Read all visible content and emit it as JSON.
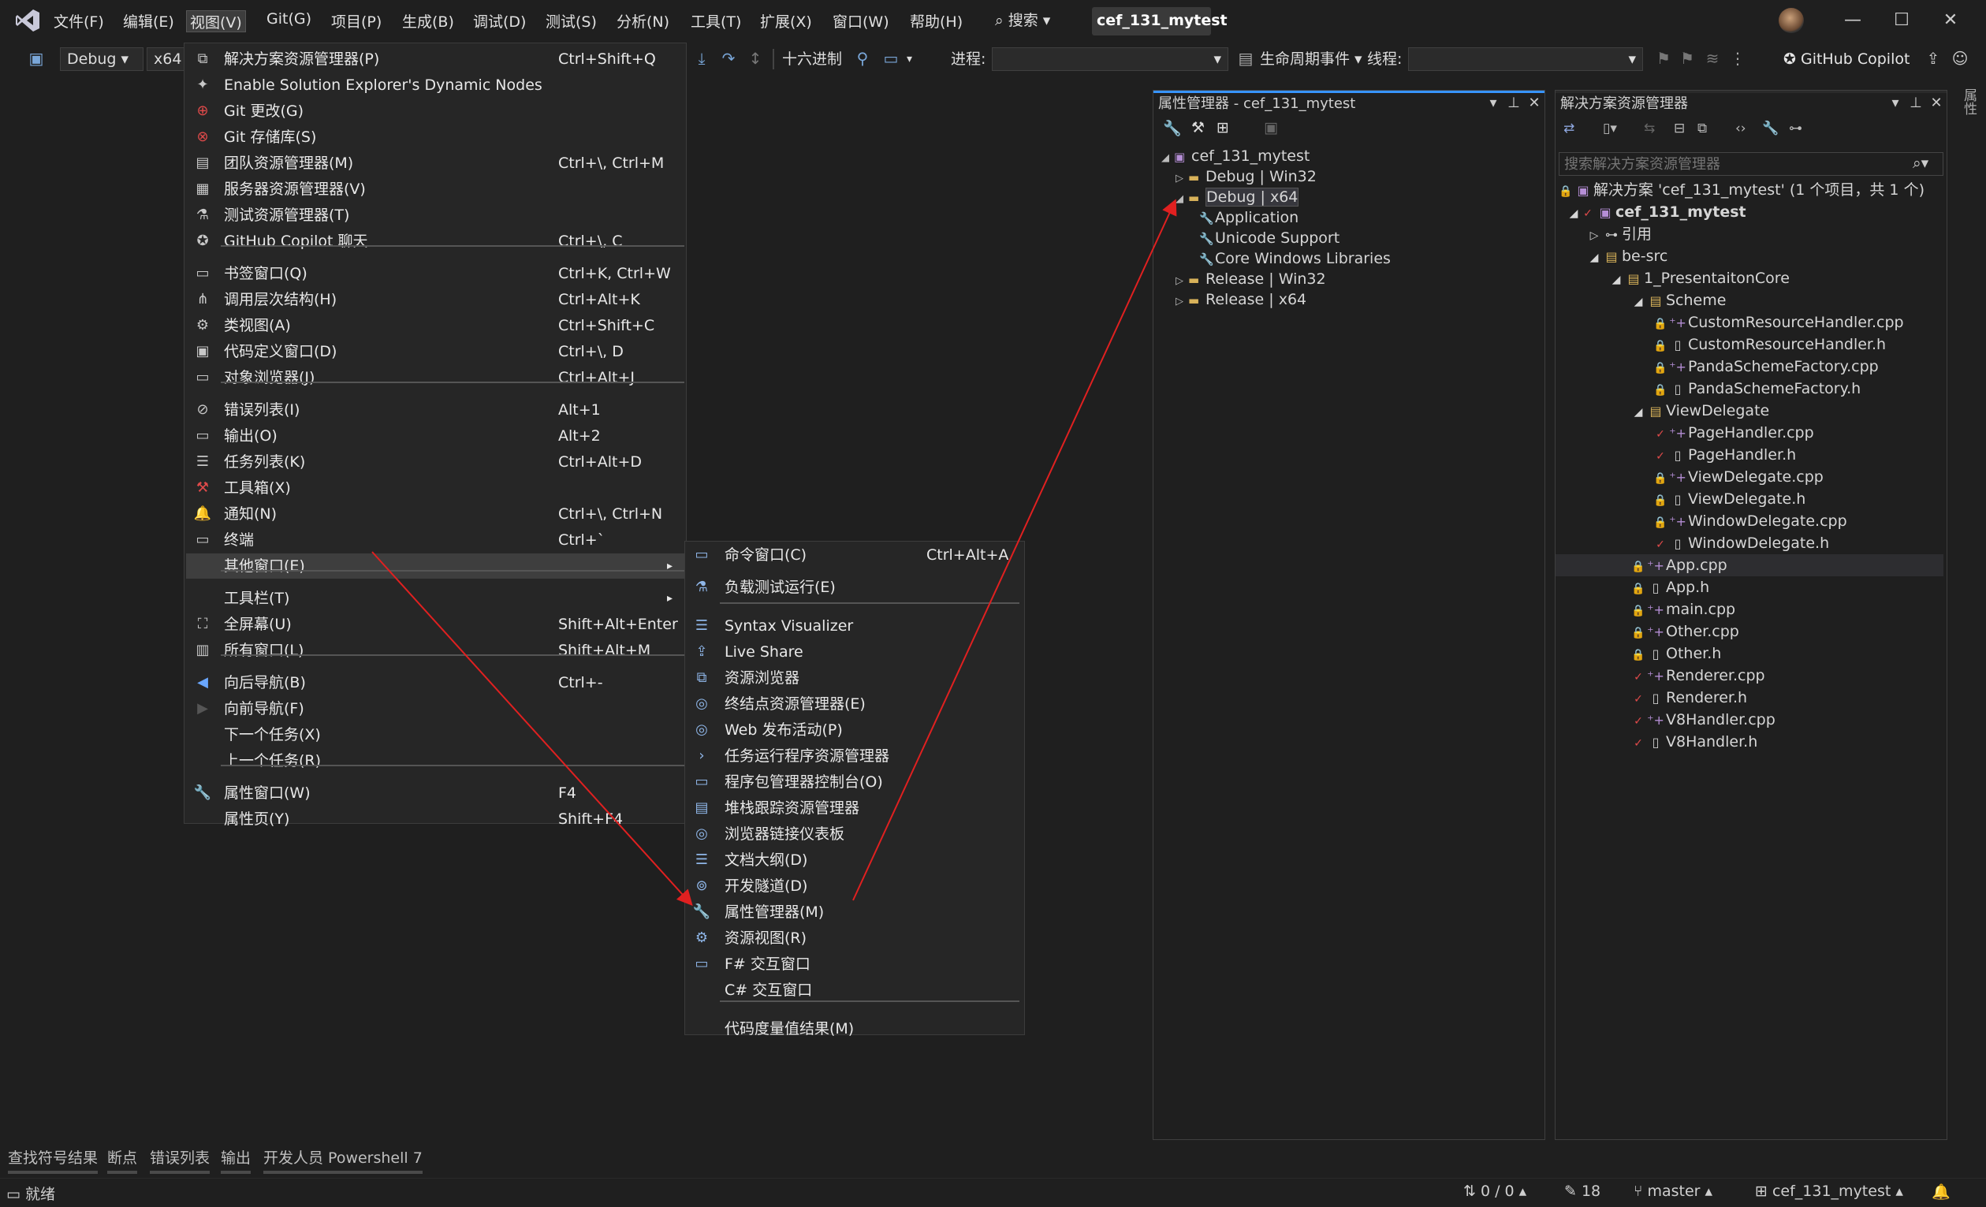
{
  "menubar": {
    "items": [
      "文件(F)",
      "编辑(E)",
      "视图(V)",
      "Git(G)",
      "项目(P)",
      "生成(B)",
      "调试(D)",
      "测试(S)",
      "分析(N)",
      "工具(T)",
      "扩展(X)",
      "窗口(W)",
      "帮助(H)"
    ],
    "search": "搜索",
    "solution_name": "cef_131_mytest"
  },
  "toolbar": {
    "config": "Debug",
    "platform": "x64",
    "hex_label": "十六进制",
    "process_label": "进程:",
    "lifecycle_label": "生命周期事件",
    "thread_label": "线程:",
    "copilot": "GitHub Copilot"
  },
  "view_menu": {
    "items": [
      {
        "label": "解决方案资源管理器(P)",
        "shortcut": "Ctrl+Shift+Q",
        "icon": "solution-explorer-icon"
      },
      {
        "label": "Enable Solution Explorer's Dynamic Nodes",
        "shortcut": "",
        "icon": "dynamic-nodes-icon"
      },
      {
        "label": "Git 更改(G)",
        "shortcut": "",
        "icon": "git-changes-icon"
      },
      {
        "label": "Git 存储库(S)",
        "shortcut": "",
        "icon": "git-repo-icon"
      },
      {
        "label": "团队资源管理器(M)",
        "shortcut": "Ctrl+\\, Ctrl+M",
        "icon": "team-explorer-icon"
      },
      {
        "label": "服务器资源管理器(V)",
        "shortcut": "",
        "icon": "server-explorer-icon"
      },
      {
        "label": "测试资源管理器(T)",
        "shortcut": "",
        "icon": "test-explorer-icon"
      },
      {
        "label": "GitHub Copilot 聊天",
        "shortcut": "Ctrl+\\, C",
        "icon": "copilot-icon"
      },
      {
        "label": "书签窗口(Q)",
        "shortcut": "Ctrl+K, Ctrl+W",
        "icon": "bookmark-icon"
      },
      {
        "label": "调用层次结构(H)",
        "shortcut": "Ctrl+Alt+K",
        "icon": "call-hierarchy-icon"
      },
      {
        "label": "类视图(A)",
        "shortcut": "Ctrl+Shift+C",
        "icon": "class-view-icon"
      },
      {
        "label": "代码定义窗口(D)",
        "shortcut": "Ctrl+\\, D",
        "icon": "code-definition-icon"
      },
      {
        "label": "对象浏览器(J)",
        "shortcut": "Ctrl+Alt+J",
        "icon": "object-browser-icon"
      },
      {
        "label": "错误列表(I)",
        "shortcut": "Alt+1",
        "icon": "error-list-icon"
      },
      {
        "label": "输出(O)",
        "shortcut": "Alt+2",
        "icon": "output-icon"
      },
      {
        "label": "任务列表(K)",
        "shortcut": "Ctrl+Alt+D",
        "icon": "task-list-icon"
      },
      {
        "label": "工具箱(X)",
        "shortcut": "",
        "icon": "toolbox-icon"
      },
      {
        "label": "通知(N)",
        "shortcut": "Ctrl+\\, Ctrl+N",
        "icon": "bell-icon"
      },
      {
        "label": "终端",
        "shortcut": "Ctrl+`",
        "icon": "terminal-icon"
      },
      {
        "label": "其他窗口(E)",
        "shortcut": "",
        "icon": "",
        "submenu": true
      },
      {
        "label": "工具栏(T)",
        "shortcut": "",
        "icon": "",
        "submenu": true
      },
      {
        "label": "全屏幕(U)",
        "shortcut": "Shift+Alt+Enter",
        "icon": "fullscreen-icon"
      },
      {
        "label": "所有窗口(L)",
        "shortcut": "Shift+Alt+M",
        "icon": "all-windows-icon"
      },
      {
        "label": "向后导航(B)",
        "shortcut": "Ctrl+-",
        "icon": "back-arrow-icon"
      },
      {
        "label": "向前导航(F)",
        "shortcut": "",
        "icon": "forward-arrow-icon"
      },
      {
        "label": "下一个任务(X)",
        "shortcut": "",
        "icon": ""
      },
      {
        "label": "上一个任务(R)",
        "shortcut": "",
        "icon": ""
      },
      {
        "label": "属性窗口(W)",
        "shortcut": "F4",
        "icon": "wrench-icon"
      },
      {
        "label": "属性页(Y)",
        "shortcut": "Shift+F4",
        "icon": ""
      }
    ]
  },
  "other_windows_menu": {
    "items": [
      {
        "label": "命令窗口(C)",
        "shortcut": "Ctrl+Alt+A"
      },
      {
        "label": "负载测试运行(E)",
        "shortcut": ""
      },
      {
        "label": "Syntax Visualizer",
        "shortcut": ""
      },
      {
        "label": "Live Share",
        "shortcut": ""
      },
      {
        "label": "资源浏览器",
        "shortcut": ""
      },
      {
        "label": "终结点资源管理器(E)",
        "shortcut": ""
      },
      {
        "label": "Web 发布活动(P)",
        "shortcut": ""
      },
      {
        "label": "任务运行程序资源管理器",
        "shortcut": ""
      },
      {
        "label": "程序包管理器控制台(O)",
        "shortcut": ""
      },
      {
        "label": "堆栈跟踪资源管理器",
        "shortcut": ""
      },
      {
        "label": "浏览器链接仪表板",
        "shortcut": ""
      },
      {
        "label": "文档大纲(D)",
        "shortcut": ""
      },
      {
        "label": "开发隧道(D)",
        "shortcut": ""
      },
      {
        "label": "属性管理器(M)",
        "shortcut": ""
      },
      {
        "label": "资源视图(R)",
        "shortcut": ""
      },
      {
        "label": "F# 交互窗口",
        "shortcut": ""
      },
      {
        "label": "C# 交互窗口",
        "shortcut": ""
      },
      {
        "label": "代码度量值结果(M)",
        "shortcut": ""
      }
    ]
  },
  "property_manager": {
    "title": "属性管理器 - cef_131_mytest",
    "project": "cef_131_mytest",
    "nodes": [
      "Debug | Win32",
      "Debug | x64",
      "Application",
      "Unicode Support",
      "Core Windows Libraries",
      "Release | Win32",
      "Release | x64"
    ]
  },
  "solution_explorer": {
    "title": "解决方案资源管理器",
    "search_placeholder": "搜索解决方案资源管理器",
    "solution": "解决方案 'cef_131_mytest' (1 个项目，共 1 个)",
    "project": "cef_131_mytest",
    "items": [
      {
        "label": "引用",
        "indent": 1,
        "kind": "ref"
      },
      {
        "label": "be-src",
        "indent": 1,
        "kind": "folder"
      },
      {
        "label": "1_PresentaitonCore",
        "indent": 2,
        "kind": "folder"
      },
      {
        "label": "Scheme",
        "indent": 3,
        "kind": "folder"
      },
      {
        "label": "CustomResourceHandler.cpp",
        "indent": 4,
        "kind": "cpp",
        "status": "lock"
      },
      {
        "label": "CustomResourceHandler.h",
        "indent": 4,
        "kind": "h",
        "status": "lock"
      },
      {
        "label": "PandaSchemeFactory.cpp",
        "indent": 4,
        "kind": "cpp",
        "status": "lock"
      },
      {
        "label": "PandaSchemeFactory.h",
        "indent": 4,
        "kind": "h",
        "status": "lock"
      },
      {
        "label": "ViewDelegate",
        "indent": 3,
        "kind": "folder"
      },
      {
        "label": "PageHandler.cpp",
        "indent": 4,
        "kind": "cpp",
        "status": "check"
      },
      {
        "label": "PageHandler.h",
        "indent": 4,
        "kind": "h",
        "status": "check"
      },
      {
        "label": "ViewDelegate.cpp",
        "indent": 4,
        "kind": "cpp",
        "status": "lock"
      },
      {
        "label": "ViewDelegate.h",
        "indent": 4,
        "kind": "h",
        "status": "lock"
      },
      {
        "label": "WindowDelegate.cpp",
        "indent": 4,
        "kind": "cpp",
        "status": "lock"
      },
      {
        "label": "WindowDelegate.h",
        "indent": 4,
        "kind": "h",
        "status": "check"
      },
      {
        "label": "App.cpp",
        "indent": 3,
        "kind": "cpp",
        "status": "lock"
      },
      {
        "label": "App.h",
        "indent": 3,
        "kind": "h",
        "status": "lock"
      },
      {
        "label": "main.cpp",
        "indent": 3,
        "kind": "cpp",
        "status": "lock"
      },
      {
        "label": "Other.cpp",
        "indent": 3,
        "kind": "cpp",
        "status": "lock"
      },
      {
        "label": "Other.h",
        "indent": 3,
        "kind": "h",
        "status": "lock"
      },
      {
        "label": "Renderer.cpp",
        "indent": 3,
        "kind": "cpp",
        "status": "check"
      },
      {
        "label": "Renderer.h",
        "indent": 3,
        "kind": "h",
        "status": "check"
      },
      {
        "label": "V8Handler.cpp",
        "indent": 3,
        "kind": "cpp",
        "status": "check"
      },
      {
        "label": "V8Handler.h",
        "indent": 3,
        "kind": "h",
        "status": "check"
      }
    ]
  },
  "side_tab": "属性",
  "bottom_tabs": [
    "查找符号结果",
    "断点",
    "错误列表",
    "输出",
    "开发人员 Powershell 7"
  ],
  "statusbar": {
    "ready": "就绪",
    "sync": "0 / 0",
    "edits": "18",
    "branch": "master",
    "repo": "cef_131_mytest"
  },
  "colors": {
    "accent": "#3794ff",
    "arrow": "#e02020",
    "background": "#1f1f1f",
    "menu": "#262626"
  }
}
